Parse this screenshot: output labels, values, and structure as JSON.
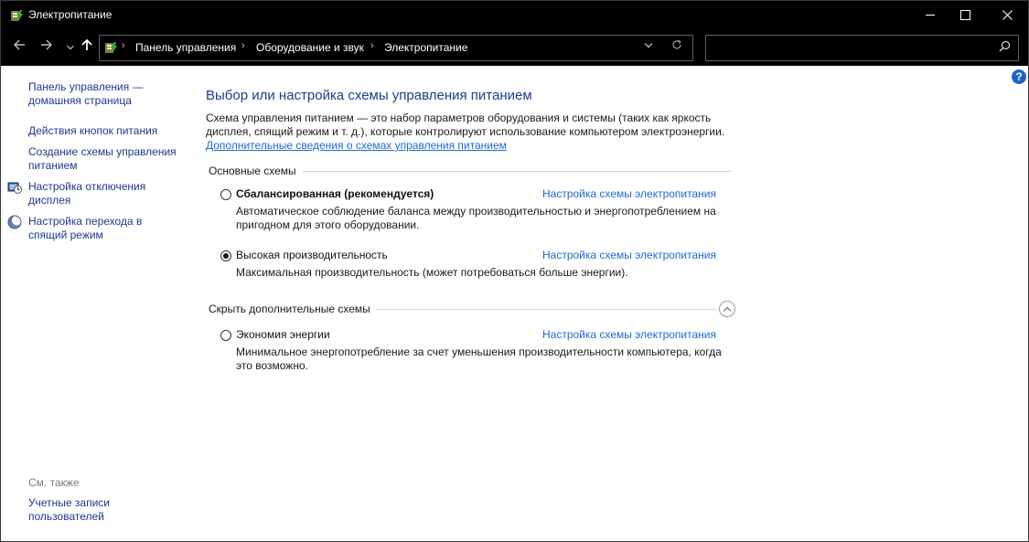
{
  "window": {
    "title": "Электропитание"
  },
  "breadcrumbs": [
    "Панель управления",
    "Оборудование и звук",
    "Электропитание"
  ],
  "search": {
    "placeholder": ""
  },
  "sidebar": {
    "items": [
      {
        "label": "Панель управления — домашняя страница"
      },
      {
        "label": "Действия кнопок питания"
      },
      {
        "label": "Создание схемы управления питанием"
      },
      {
        "label": "Настройка отключения дисплея"
      },
      {
        "label": "Настройка перехода в спящий режим"
      }
    ],
    "see_also": "См. также",
    "see_also_items": [
      {
        "label": "Учетные записи пользователей"
      }
    ]
  },
  "main": {
    "title": "Выбор или настройка схемы управления питанием",
    "description": "Схема управления питанием — это набор параметров оборудования и системы (таких как яркость дисплея, спящий режим и т. д.), которые контролируют использование компьютером электроэнергии.",
    "more_link": "Дополнительные сведения о схемах управления питанием",
    "group_basic": "Основные схемы",
    "group_hidden": "Скрыть дополнительные схемы",
    "plans": [
      {
        "name": "Сбалансированная (рекомендуется)",
        "link": "Настройка схемы электропитания",
        "description": "Автоматическое соблюдение баланса между производительностью и энергопотреблением на пригодном для этого оборудовании.",
        "selected": false
      },
      {
        "name": "Высокая производительность",
        "link": "Настройка схемы электропитания",
        "description": "Максимальная производительность (может потребоваться больше энергии).",
        "selected": true
      },
      {
        "name": "Экономия энергии",
        "link": "Настройка схемы электропитания",
        "description": "Минимальное энергопотребление за счет уменьшения производительности компьютера, когда это возможно.",
        "selected": false
      }
    ]
  },
  "icons": {
    "back": "arrow-left-icon",
    "forward": "arrow-right-icon",
    "recent": "chevron-down-icon",
    "up": "arrow-up-icon",
    "refresh": "refresh-icon",
    "search": "search-icon",
    "help": "help-icon",
    "collapse": "chevron-up-icon"
  },
  "colors": {
    "link": "#1b6ad1",
    "heading": "#1e3c8f",
    "titlebar": "#000000"
  }
}
